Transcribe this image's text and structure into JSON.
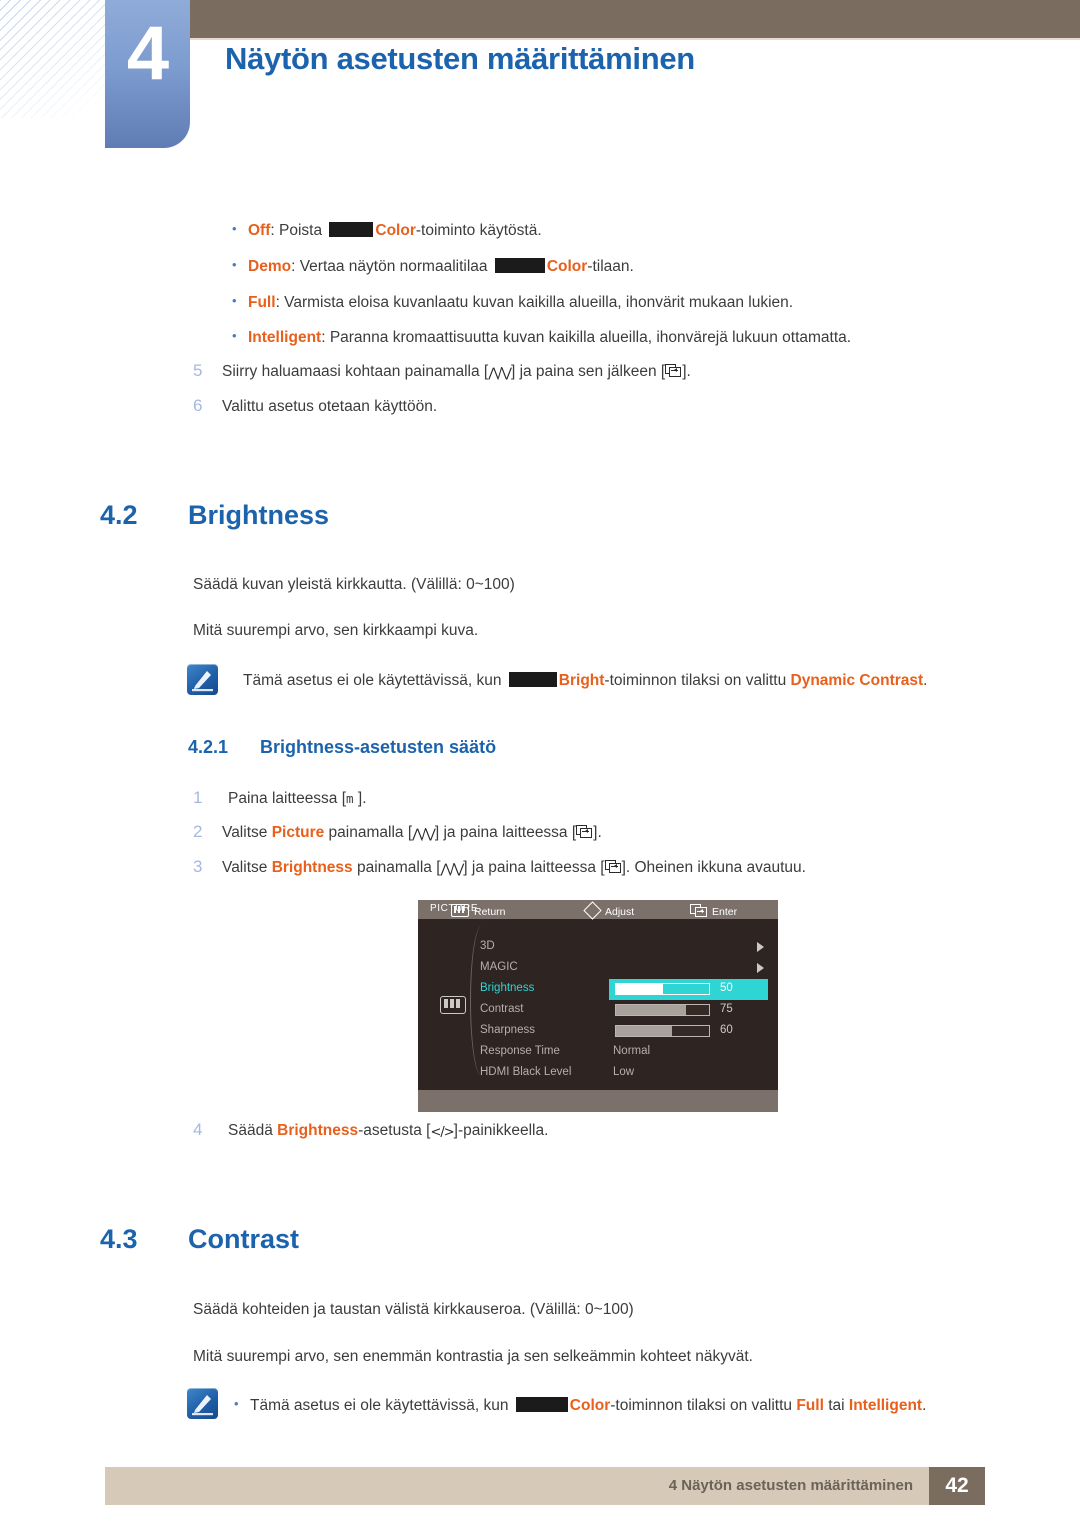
{
  "header": {
    "chapter_number": "4",
    "chapter_title": "Näytön asetusten määrittäminen"
  },
  "bullets": [
    {
      "term": "Off",
      "rest_before": ": Poista ",
      "rest_after": "Color-toiminto käytöstä."
    },
    {
      "term": "Demo",
      "rest_before": ": Vertaa näytön normaalitilaa ",
      "rest_after": "Color-tilaan."
    },
    {
      "term": "Full",
      "rest_before": ": Varmista eloisa kuvanlaatu kuvan kaikilla alueilla, ihonvärit mukaan lukien.",
      "rest_after": ""
    },
    {
      "term": "Intelligent",
      "rest_before": ": Paranna kromaattisuutta kuvan kaikilla alueilla, ihonvärejä lukuun ottamatta.",
      "rest_after": ""
    }
  ],
  "top_steps": [
    {
      "num": "5",
      "part1": "Siirry haluamaasi kohtaan painamalla [",
      "part2": "] ja paina sen jälkeen [",
      "part3": "]."
    },
    {
      "num": "6",
      "part1": "Valittu asetus otetaan käyttöön.",
      "part2": "",
      "part3": ""
    }
  ],
  "section_42": {
    "number": "4.2",
    "title": "Brightness",
    "para1": "Säädä kuvan yleistä kirkkautta. (Välillä: 0~100)",
    "para2": "Mitä suurempi arvo, sen kirkkaampi kuva.",
    "note_pre": "Tämä asetus ei ole käytettävissä, kun ",
    "note_term1": "Bright",
    "note_mid": "-toiminnon tilaksi on valittu ",
    "note_term2": "Dynamic Contrast",
    "note_end": "."
  },
  "section_421": {
    "number": "4.2.1",
    "title": "Brightness-asetusten säätö",
    "steps": [
      {
        "num": "1",
        "pre": "Paina laitteessa [",
        "key": "m",
        "post": " ]."
      },
      {
        "num": "2",
        "pre": "Valitse ",
        "term": "Picture",
        "mid": " painamalla [",
        "post": "] ja paina laitteessa [",
        "tail": "]."
      },
      {
        "num": "3",
        "pre": "Valitse ",
        "term": "Brightness",
        "mid": " painamalla [",
        "post": "] ja paina laitteessa [",
        "tail": "]. Oheinen ikkuna avautuu."
      },
      {
        "num": "4",
        "pre": "Säädä ",
        "term": "Brightness",
        "post": "-asetusta [",
        "tail": "]-painikkeella."
      }
    ]
  },
  "osd": {
    "title": "PICTURE",
    "rows": [
      {
        "label": "3D",
        "kind": "submenu",
        "value": ""
      },
      {
        "label": "MAGIC",
        "kind": "submenu",
        "value": ""
      },
      {
        "label": "Brightness",
        "kind": "slider",
        "value": "50",
        "percent": 50,
        "selected": true
      },
      {
        "label": "Contrast",
        "kind": "slider",
        "value": "75",
        "percent": 75,
        "selected": false
      },
      {
        "label": "Sharpness",
        "kind": "slider",
        "value": "60",
        "percent": 60,
        "selected": false
      },
      {
        "label": "Response Time",
        "kind": "option",
        "value": "Normal"
      },
      {
        "label": "HDMI Black Level",
        "kind": "option",
        "value": "Low"
      }
    ],
    "footer": {
      "return": "Return",
      "adjust": "Adjust",
      "enter": "Enter"
    }
  },
  "section_43": {
    "number": "4.3",
    "title": "Contrast",
    "para1": "Säädä kohteiden ja taustan välistä kirkkauseroa. (Välillä: 0~100)",
    "para2": "Mitä suurempi arvo, sen enemmän kontrastia ja sen selkeämmin kohteet näkyvät.",
    "note_pre": "Tämä asetus ei ole käytettävissä, kun ",
    "note_term1": "Color",
    "note_mid": "-toiminnon tilaksi on valittu ",
    "note_term2": "Full",
    "note_mid2": " tai ",
    "note_term3": "Intelligent",
    "note_end": "."
  },
  "footer": {
    "text": "4 Näytön asetusten määrittäminen",
    "page": "42"
  },
  "colors": {
    "heading_blue": "#1c63ad",
    "accent_orange": "#e8601c",
    "header_brown": "#7a6c5e",
    "footer_beige": "#d6c9b8",
    "osd_bg": "#2e2522",
    "osd_cyan": "#2fd4d4"
  }
}
